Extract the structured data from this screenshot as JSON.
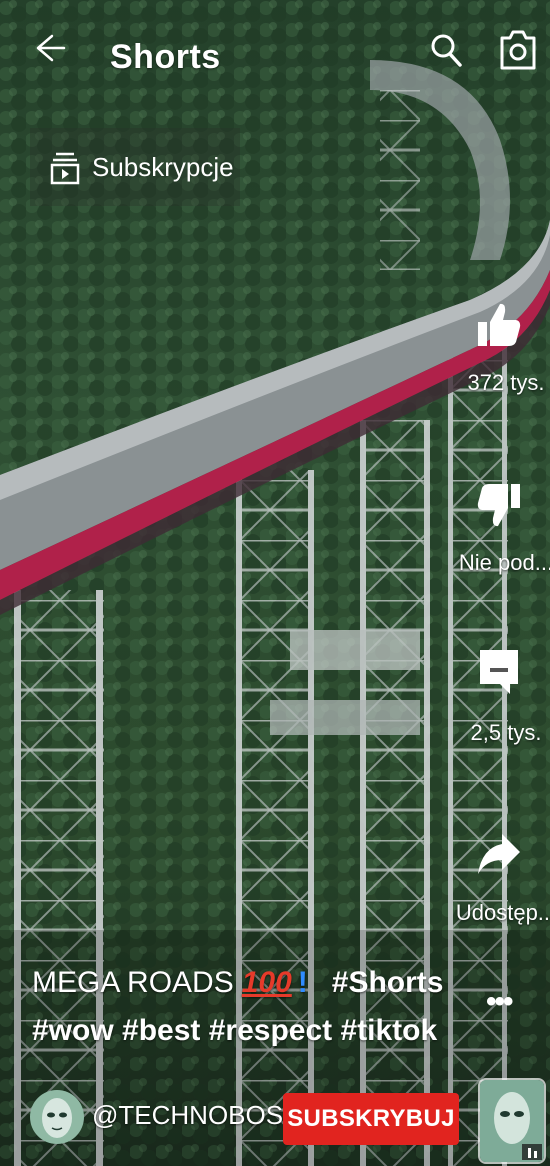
{
  "header": {
    "title": "Shorts",
    "back_icon": "back-arrow-icon",
    "search_icon": "search-icon",
    "camera_icon": "camera-icon"
  },
  "subscriptions_chip": {
    "label": "Subskrypcje",
    "icon": "subscriptions-icon"
  },
  "actions": {
    "like": {
      "label": "372 tys.",
      "icon": "thumbs-up-icon"
    },
    "dislike": {
      "label": "Nie pod...",
      "icon": "thumbs-down-icon"
    },
    "comments": {
      "label": "2,5 tys.",
      "icon": "comment-icon"
    },
    "share": {
      "label": "Udostęp...",
      "icon": "share-icon"
    },
    "more": {
      "label": "•••",
      "icon": "more-icon"
    }
  },
  "video": {
    "caption_line1_text": "MEGA ROADS",
    "caption_emoji_100": "100",
    "caption_emoji_excl": "!",
    "caption_line1_tag": "#Shorts",
    "caption_line2": "#wow #best #respect #tiktok",
    "channel_handle": "@TECHNOBOS..",
    "subscribe_label": "SUBSKRYBUJ"
  },
  "colors": {
    "subscribe_bg": "#e1241f",
    "foliage": "#2c4a30",
    "bridge_rail": "#b0214a"
  }
}
